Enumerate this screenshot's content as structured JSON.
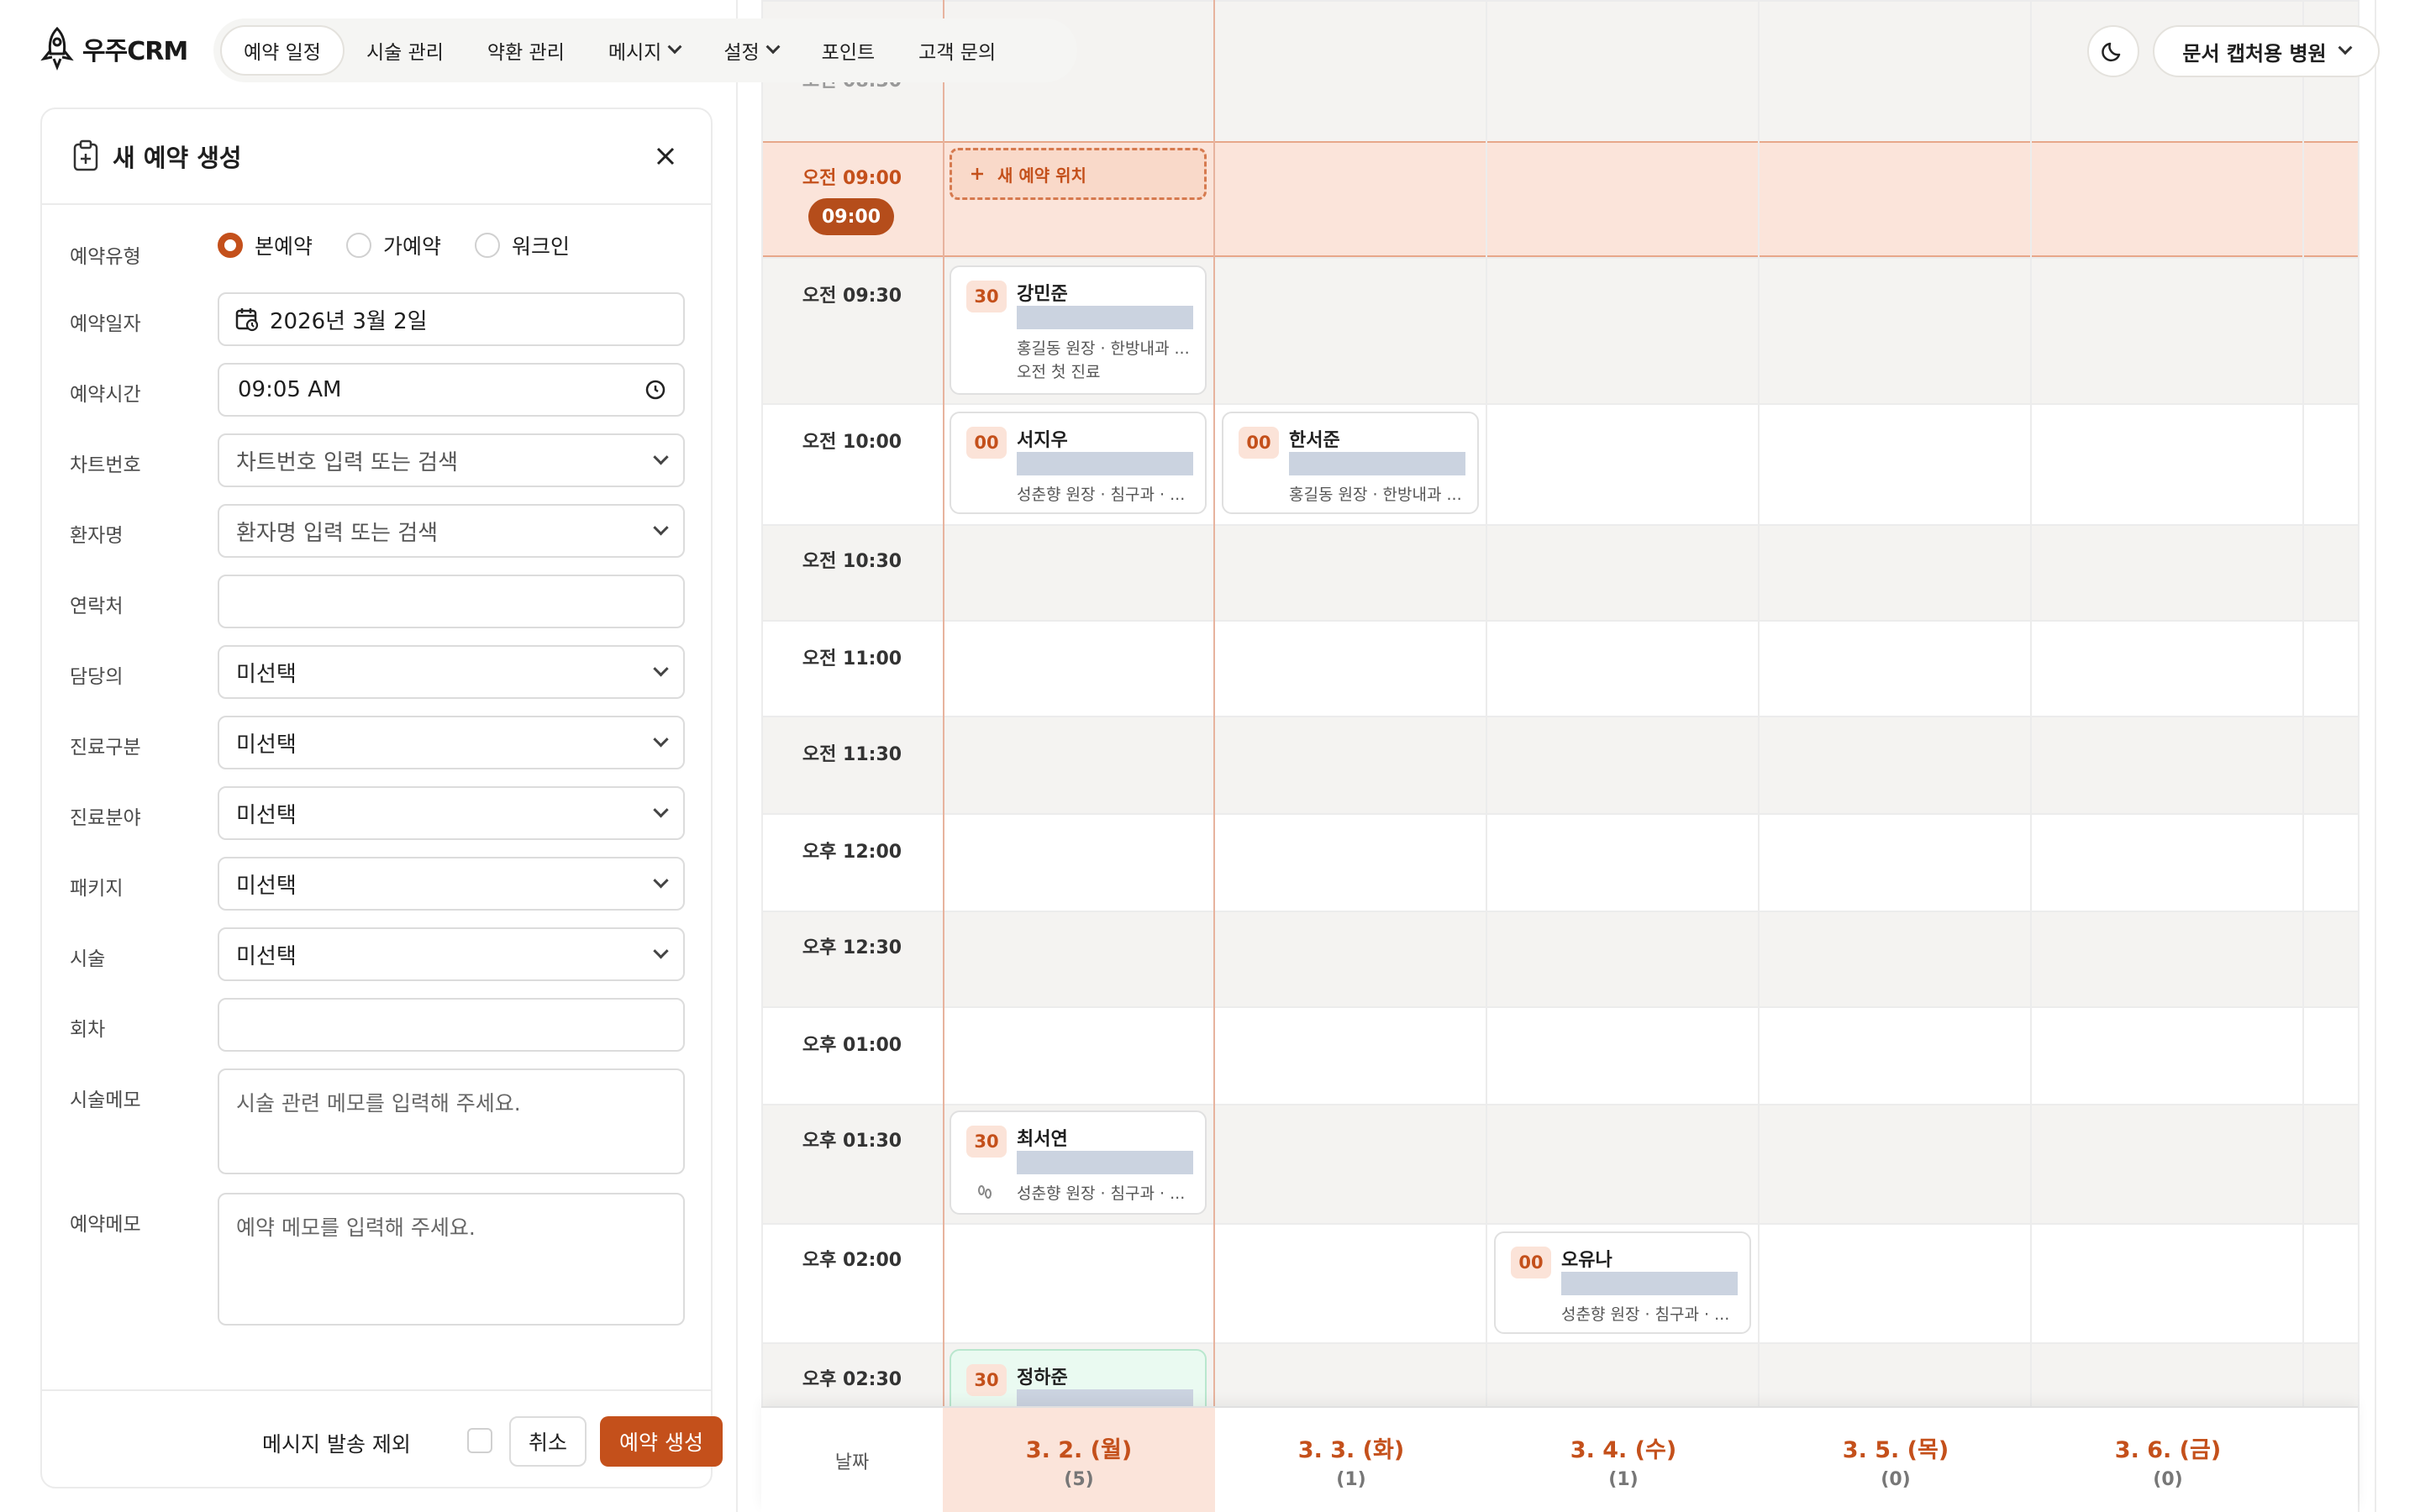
{
  "app": {
    "logo_text": "우주CRM"
  },
  "nav": {
    "items": [
      "예약 일정",
      "시술 관리",
      "약환 관리",
      "메시지",
      "설정",
      "포인트",
      "고객 문의"
    ],
    "hospital": "문서 캡처용 병원"
  },
  "panel": {
    "title": "새 예약 생성",
    "labels": {
      "type": "예약유형",
      "date": "예약일자",
      "time": "예약시간",
      "chart": "차트번호",
      "patient": "환자명",
      "phone": "연락처",
      "doctor": "담당의",
      "category": "진료구분",
      "field": "진료분야",
      "package": "패키지",
      "treatment": "시술",
      "session": "회차",
      "treat_memo": "시술메모",
      "appt_memo": "예약메모"
    },
    "radios": [
      "본예약",
      "가예약",
      "워크인"
    ],
    "date_value": "2026년 3월 2일",
    "time_value": "09:05 AM",
    "chart_placeholder": "차트번호 입력 또는 검색",
    "patient_placeholder": "환자명 입력 또는 검색",
    "unselected": "미선택",
    "treat_memo_placeholder": "시술 관련 메모를 입력해 주세요.",
    "appt_memo_placeholder": "예약 메모를 입력해 주세요.",
    "exclude_message": "메시지 발송 제외",
    "cancel": "취소",
    "create": "예약 생성"
  },
  "calendar": {
    "times": [
      "오전 08:30",
      "오전 09:00",
      "오전 09:30",
      "오전 10:00",
      "오전 10:30",
      "오전 11:00",
      "오전 11:30",
      "오후 12:00",
      "오후 12:30",
      "오후 01:00",
      "오후 01:30",
      "오후 02:00",
      "오후 02:30"
    ],
    "now_pill": "09:00",
    "new_slot": "새 예약 위치",
    "date_label": "날짜",
    "dates": [
      {
        "label": "3. 2. (월)",
        "count": "(5)"
      },
      {
        "label": "3. 3. (화)",
        "count": "(1)"
      },
      {
        "label": "3. 4. (수)",
        "count": "(1)"
      },
      {
        "label": "3. 5. (목)",
        "count": "(0)"
      },
      {
        "label": "3. 6. (금)",
        "count": "(0)"
      }
    ],
    "appointments": [
      {
        "badge": "30",
        "name": "강민준",
        "line1": "홍길동 원장 · 한방내과 ...",
        "line2": "오전 첫 진료"
      },
      {
        "badge": "00",
        "name": "서지우",
        "line1": "성춘향 원장 · 침구과 · ..."
      },
      {
        "badge": "00",
        "name": "한서준",
        "line1": "홍길동 원장 · 한방내과 ..."
      },
      {
        "badge": "30",
        "name": "최서연",
        "line1": "성춘향 원장 · 침구과 · ..."
      },
      {
        "badge": "00",
        "name": "오유나",
        "line1": "성춘향 원장 · 침구과 · ..."
      },
      {
        "badge": "30",
        "name": "정하준"
      }
    ]
  },
  "colors": {
    "accent": "#c4501b",
    "now_band": "#fbe4da",
    "shade": "#f4f3f1"
  },
  "icons": [
    "rocket-icon",
    "moon-icon",
    "chevron-down-icon",
    "clipboard-plus-icon",
    "close-icon",
    "calendar-icon",
    "clock-icon",
    "plus-icon",
    "footprints-icon"
  ]
}
